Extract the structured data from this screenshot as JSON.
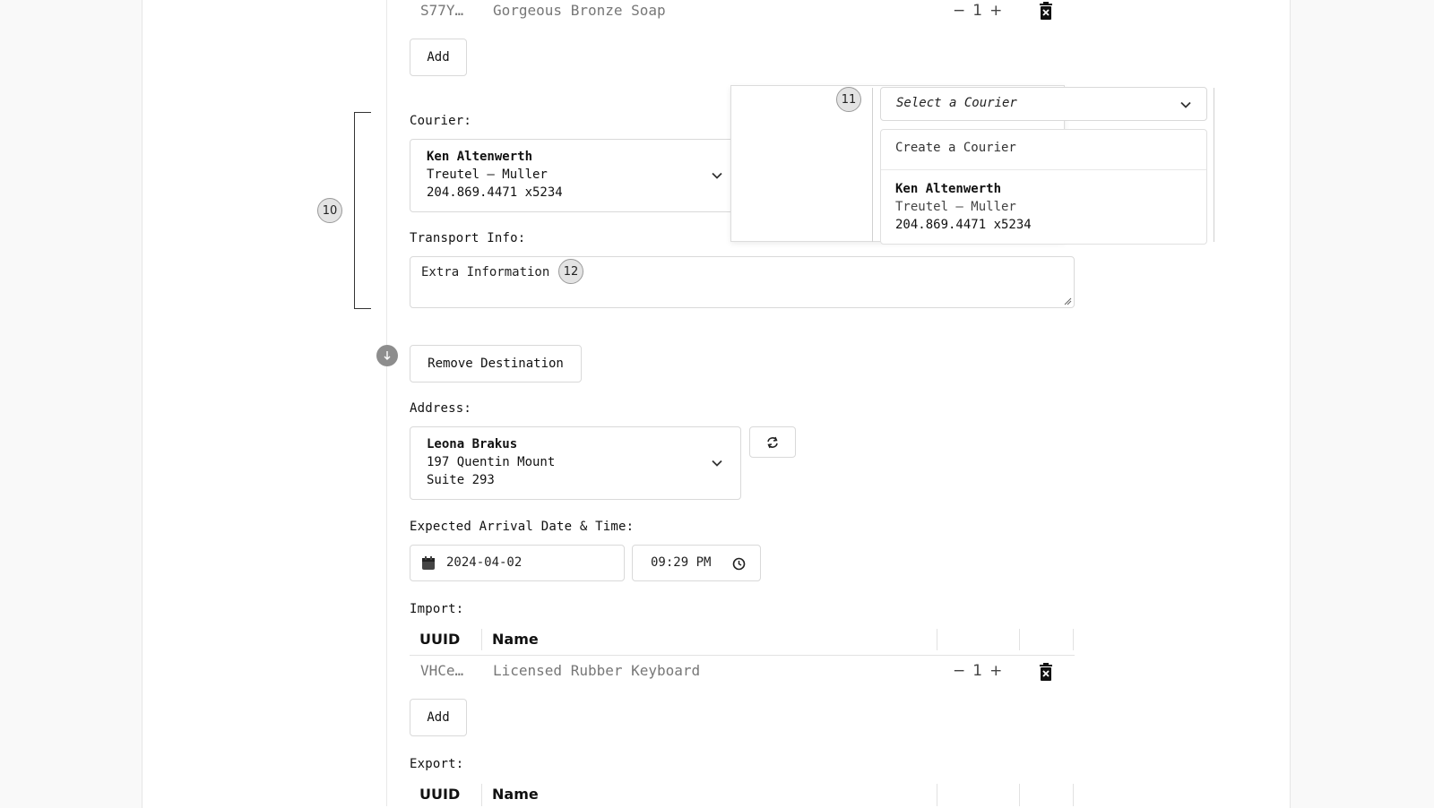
{
  "top_row": {
    "uuid": "S77Y…",
    "name": "Gorgeous Bronze Soap",
    "qty": "1",
    "minus": "−",
    "plus": "+"
  },
  "add_label": "Add",
  "courier": {
    "label": "Courier:",
    "name": "Ken Altenwerth",
    "company": "Treutel – Muller",
    "phone": "204.869.4471 x5234"
  },
  "transport": {
    "label": "Transport Info:",
    "placeholder": "Extra Information"
  },
  "courier_dropdown": {
    "placeholder": "Select a Courier",
    "create_option": "Create a Courier",
    "option": {
      "name": "Ken Altenwerth",
      "company": "Treutel – Muller",
      "phone": "204.869.4471 x5234"
    }
  },
  "markers": {
    "m10": "10",
    "m11": "11",
    "m12": "12"
  },
  "remove_destination": "Remove Destination",
  "address": {
    "label": "Address:",
    "name": "Leona Brakus",
    "line1": "197 Quentin Mount",
    "line2": "Suite 293"
  },
  "arrival": {
    "label": "Expected Arrival Date & Time:",
    "date": "2024-04-02",
    "time": "09:29 PM"
  },
  "import": {
    "label": "Import:",
    "columns": [
      "UUID",
      "Name"
    ],
    "row": {
      "uuid": "VHCe…",
      "name": "Licensed Rubber Keyboard",
      "qty": "1",
      "minus": "−",
      "plus": "+"
    },
    "add_label": "Add"
  },
  "export": {
    "label": "Export:",
    "columns": [
      "UUID",
      "Name"
    ]
  },
  "icons": {
    "trash": "trash-icon",
    "refresh": "refresh-icon",
    "chevron": "chevron-down-icon",
    "calendar": "calendar-icon",
    "clock": "clock-icon",
    "arrow_down": "arrow-down-icon"
  }
}
